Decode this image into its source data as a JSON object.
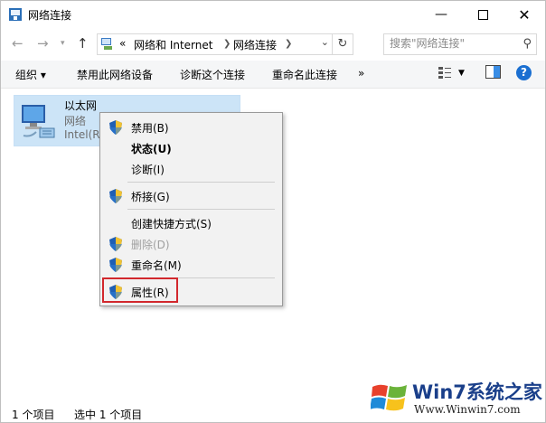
{
  "window": {
    "title": "网络连接",
    "controls": {
      "minimize_icon": "minimize-icon",
      "maximize_icon": "maximize-icon",
      "close_icon": "close-icon"
    }
  },
  "address": {
    "prefix": "«",
    "crumbs": [
      "网络和 Internet",
      "网络连接"
    ],
    "search_placeholder": "搜索\"网络连接\""
  },
  "commands": {
    "organize": "组织 ▾",
    "disable": "禁用此网络设备",
    "diagnose": "诊断这个连接",
    "rename": "重命名此连接",
    "more": "»"
  },
  "item": {
    "name": "以太网",
    "network": "网络",
    "adapter": "Intel(R)"
  },
  "menu": {
    "items": [
      {
        "label": "禁用(B)",
        "shield": true,
        "bold": false,
        "disabled": false
      },
      {
        "label": "状态(U)",
        "shield": false,
        "bold": true,
        "disabled": false
      },
      {
        "label": "诊断(I)",
        "shield": false,
        "bold": false,
        "disabled": false
      },
      {
        "label": "桥接(G)",
        "shield": true,
        "bold": false,
        "disabled": false
      },
      {
        "label": "创建快捷方式(S)",
        "shield": false,
        "bold": false,
        "disabled": false
      },
      {
        "label": "删除(D)",
        "shield": true,
        "bold": false,
        "disabled": true
      },
      {
        "label": "重命名(M)",
        "shield": true,
        "bold": false,
        "disabled": false
      },
      {
        "label": "属性(R)",
        "shield": true,
        "bold": false,
        "disabled": false
      }
    ]
  },
  "status": {
    "count": "1 个项目",
    "selected": "选中 1 个项目"
  },
  "watermark": {
    "brand": "Win7系统之家",
    "url": "Www.Winwin7.com"
  },
  "colors": {
    "selection": "#cce4f7",
    "highlight_box": "#d2282d",
    "help": "#1a6fd1"
  }
}
